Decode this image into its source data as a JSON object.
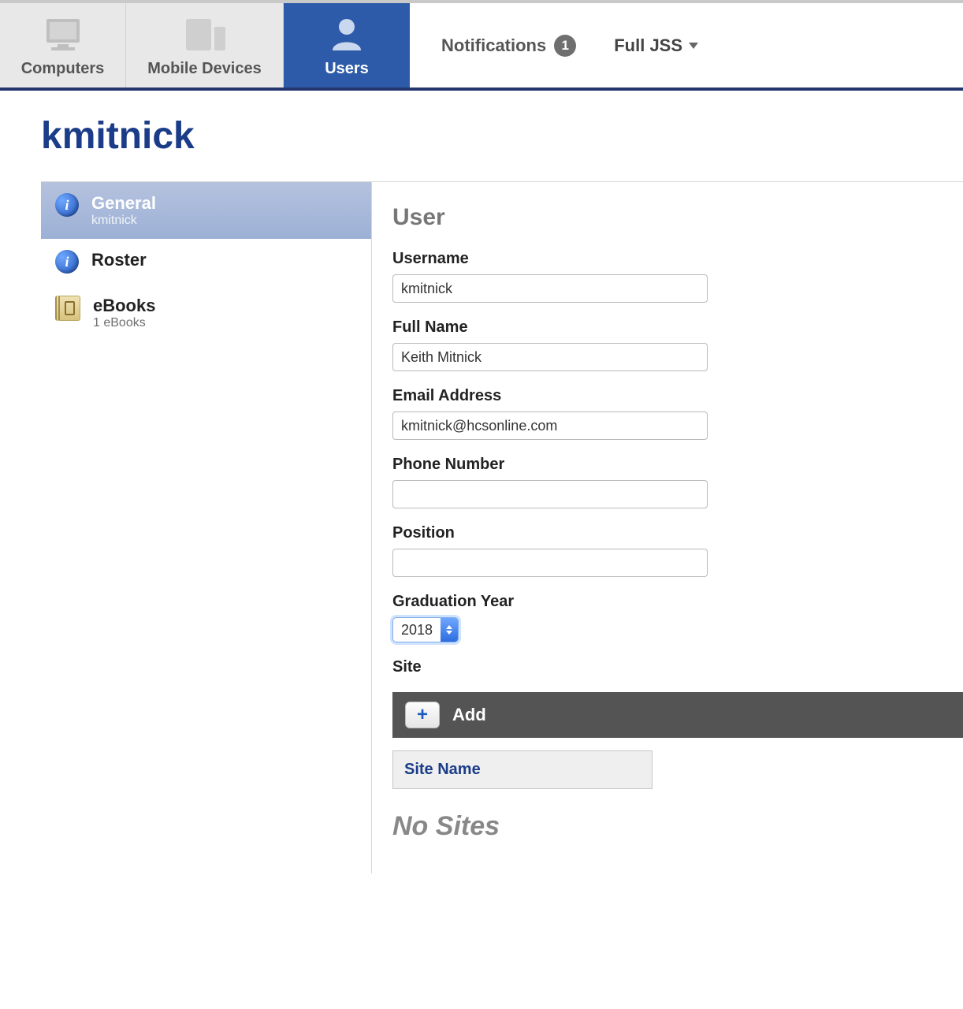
{
  "nav": {
    "computers": "Computers",
    "mobile": "Mobile Devices",
    "users": "Users",
    "notifications_label": "Notifications",
    "notifications_count": "1",
    "context_label": "Full JSS"
  },
  "page_title": "kmitnick",
  "sidebar": {
    "items": [
      {
        "title": "General",
        "subtitle": "kmitnick"
      },
      {
        "title": "Roster",
        "subtitle": ""
      },
      {
        "title": "eBooks",
        "subtitle": "1 eBooks"
      }
    ]
  },
  "form": {
    "section_heading": "User",
    "username_label": "Username",
    "username_value": "kmitnick",
    "fullname_label": "Full Name",
    "fullname_value": "Keith Mitnick",
    "email_label": "Email Address",
    "email_value": "kmitnick@hcsonline.com",
    "phone_label": "Phone Number",
    "phone_value": "",
    "position_label": "Position",
    "position_value": "",
    "gradyear_label": "Graduation Year",
    "gradyear_value": "2018",
    "site_label": "Site",
    "add_label": "Add",
    "site_table_header": "Site Name",
    "no_sites": "No Sites"
  }
}
